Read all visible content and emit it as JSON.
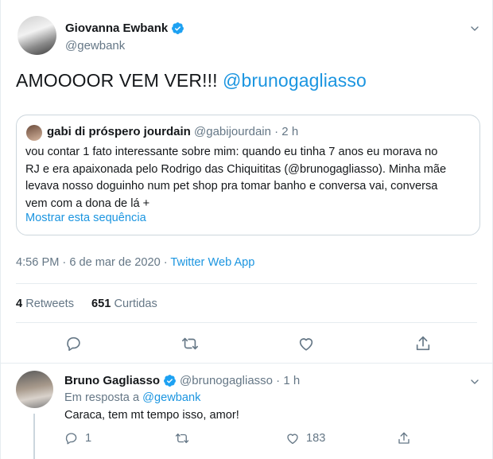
{
  "main_tweet": {
    "author": {
      "name": "Giovanna Ewbank",
      "handle": "@gewbank"
    },
    "text_plain": "AMOOOOR VEM VER!!! ",
    "text_mention": "@brunogagliasso",
    "quoted": {
      "name": "gabi di próspero jourdain",
      "handle_time": "@gabijourdain · 2 h",
      "lines": [
        "vou contar 1 fato interessante sobre mim: quando eu tinha 7 anos eu morava no",
        "RJ e era apaixonada pelo Rodrigo das Chiquititas (@brunogagliasso). Minha mãe",
        "levava nosso doguinho num pet shop pra tomar banho e conversa vai, conversa",
        "vem com a dona de lá +"
      ],
      "show_thread": "Mostrar esta sequência"
    },
    "timestamp": "4:56 PM · 6 de mar de 2020 · ",
    "source_app": "Twitter Web App",
    "stats": {
      "retweets_count": "4",
      "retweets_label": "Retweets",
      "likes_count": "651",
      "likes_label": "Curtidas"
    }
  },
  "reply": {
    "author": {
      "name": "Bruno Gagliasso",
      "handle_time": "@brunogagliasso · 1 h"
    },
    "in_reply_prefix": "Em resposta a ",
    "in_reply_handle": "@gewbank",
    "text": "Caraca, tem mt tempo isso, amor!",
    "reply_count": "1",
    "like_count": "183"
  },
  "icons": {
    "verified": "verified-badge-icon",
    "caret": "chevron-down-icon",
    "reply": "reply-icon",
    "retweet": "retweet-icon",
    "like": "heart-icon",
    "share": "share-icon"
  },
  "colors": {
    "accent": "#1b95e0",
    "muted": "#657786",
    "text": "#14171a",
    "border": "#e6ecf0"
  }
}
